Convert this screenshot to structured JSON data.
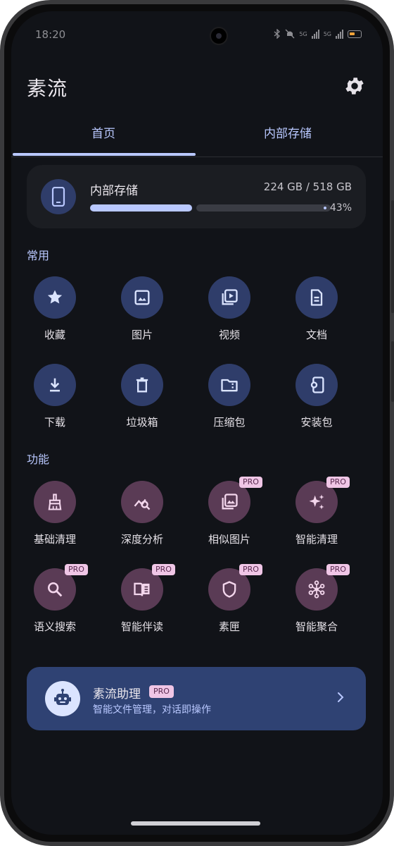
{
  "status": {
    "time": "18:20",
    "network_left": "5G",
    "network_right": "5G"
  },
  "app": {
    "title": "素流"
  },
  "tabs": [
    {
      "label": "首页"
    },
    {
      "label": "内部存储"
    }
  ],
  "storage": {
    "label": "内部存储",
    "size": "224 GB / 518 GB",
    "percent_text": "43%",
    "fill_fraction": 0.43
  },
  "sections": {
    "common": "常用",
    "features": "功能"
  },
  "common_items": [
    {
      "label": "收藏",
      "icon": "star-icon"
    },
    {
      "label": "图片",
      "icon": "image-icon"
    },
    {
      "label": "视频",
      "icon": "video-icon"
    },
    {
      "label": "文档",
      "icon": "document-icon"
    },
    {
      "label": "下载",
      "icon": "download-icon"
    },
    {
      "label": "垃圾箱",
      "icon": "trash-icon"
    },
    {
      "label": "压缩包",
      "icon": "archive-icon"
    },
    {
      "label": "安装包",
      "icon": "apk-icon"
    }
  ],
  "feature_items": [
    {
      "label": "基础清理",
      "icon": "broom-icon"
    },
    {
      "label": "深度分析",
      "icon": "analysis-icon"
    },
    {
      "label": "相似图片",
      "icon": "similar-images-icon",
      "badge": "PRO"
    },
    {
      "label": "智能清理",
      "icon": "sparkle-icon",
      "badge": "PRO"
    },
    {
      "label": "语义搜索",
      "icon": "search-icon",
      "badge": "PRO"
    },
    {
      "label": "智能伴读",
      "icon": "book-icon",
      "badge": "PRO"
    },
    {
      "label": "素匣",
      "icon": "shield-icon",
      "badge": "PRO"
    },
    {
      "label": "智能聚合",
      "icon": "hub-icon",
      "badge": "PRO"
    }
  ],
  "assistant": {
    "title": "素流助理",
    "badge": "PRO",
    "subtitle": "智能文件管理，对话即操作"
  },
  "colors": {
    "accent": "#b9c8ff",
    "blue_circle": "#2f3d6a",
    "purple_circle": "#5a3b55",
    "assistant_bg": "#2f4273",
    "pro_badge": "#f0c6e6"
  }
}
